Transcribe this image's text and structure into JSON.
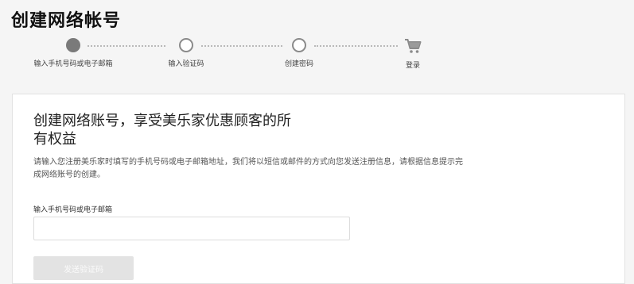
{
  "page": {
    "title": "创建网络帐号"
  },
  "stepper": {
    "steps": [
      {
        "label": "输入手机号码或电子邮箱",
        "state": "active"
      },
      {
        "label": "输入验证码",
        "state": "pending"
      },
      {
        "label": "创建密码",
        "state": "pending"
      },
      {
        "label": "登录",
        "state": "pending",
        "icon": "shopping-cart-icon"
      }
    ]
  },
  "card": {
    "headline": "创建网络账号，享受美乐家优惠顾客的所有权益",
    "description": "请输入您注册美乐家时填写的手机号码或电子邮箱地址，我们将以短信或邮件的方式向您发送注册信息，请根据信息提示完成网络账号的创建。",
    "field_label": "输入手机号码或电子邮箱",
    "field_value": "",
    "field_placeholder": "",
    "send_button_label": "发送验证码"
  }
}
